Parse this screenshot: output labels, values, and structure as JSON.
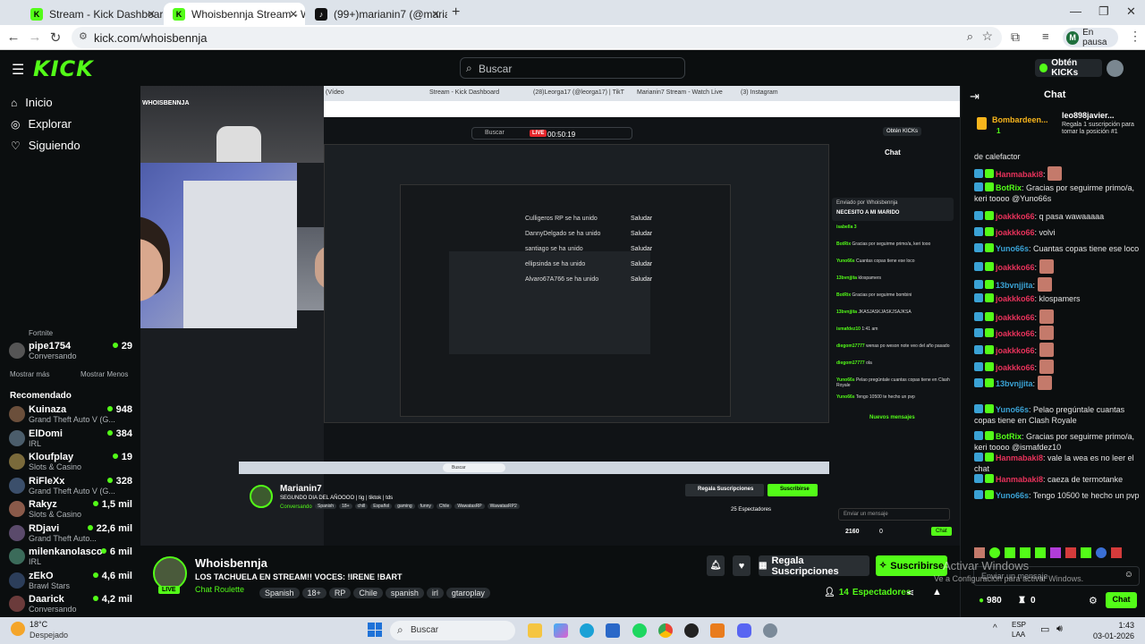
{
  "browser": {
    "tabs": [
      {
        "label": "Stream - Kick Dashboard",
        "active": false
      },
      {
        "label": "Whoisbennja Stream - Watch L",
        "active": true
      },
      {
        "label": "(99+)marianin7 (@marianin777",
        "active": false
      }
    ],
    "url": "kick.com/whoisbennja",
    "profile_label": "En pausa",
    "profile_initial": "M"
  },
  "kick": {
    "logo": "KICK",
    "search_placeholder": "Buscar",
    "get_kicks_label": "Obtén KICKs"
  },
  "sidebar": {
    "nav": [
      {
        "label": "Inicio",
        "icon": "home-icon"
      },
      {
        "label": "Explorar",
        "icon": "compass-icon"
      },
      {
        "label": "Siguiendo",
        "icon": "heart-icon"
      }
    ],
    "partial_cat": "Fortnite",
    "following_extra": {
      "name": "pipe1754",
      "category": "Conversando",
      "viewers": "29"
    },
    "show_more": "Mostrar más",
    "show_less": "Mostrar Menos",
    "recommended_title": "Recomendado",
    "recommended": [
      {
        "name": "Kuinaza",
        "category": "Grand Theft Auto V (G...",
        "viewers": "948"
      },
      {
        "name": "ElDomi",
        "category": "IRL",
        "viewers": "384"
      },
      {
        "name": "Kloufplay",
        "category": "Slots & Casino",
        "viewers": "19"
      },
      {
        "name": "RiFleXx",
        "category": "Grand Theft Auto V (G...",
        "viewers": "328"
      },
      {
        "name": "Rakyz",
        "category": "Slots & Casino",
        "viewers": "1,5 mil"
      },
      {
        "name": "RDjavi",
        "category": "Grand Theft Auto...",
        "viewers": "22,6 mil"
      },
      {
        "name": "milenkanolasco",
        "category": "IRL",
        "viewers": "6 mil"
      },
      {
        "name": "zEkO",
        "category": "Brawl Stars",
        "viewers": "4,6 mil"
      },
      {
        "name": "Daarick",
        "category": "Conversando",
        "viewers": "4,2 mil"
      }
    ]
  },
  "stream": {
    "name": "Whoisbennja",
    "title": "LOS TACHUELA EN STREAM!! VOCES: !IRENE !BART",
    "category": "Chat Roulette",
    "tags": [
      "Spanish",
      "18+",
      "RP",
      "Chile",
      "spanish",
      "irl",
      "gtaroplay"
    ],
    "live_label": "LIVE",
    "subscribe_gift_label": "Regala Suscripciones",
    "subscribe_label": "Suscribirse",
    "viewers": "14",
    "viewers_label": "Espectadores"
  },
  "video_inner": {
    "tabs": [
      "(Vídeo",
      "Stream - Kick Dashboard",
      "(28)Leorga17 (@leorga17) | TikT",
      "Marianin7 Stream - Watch Live",
      "(3) Instagram"
    ],
    "search": "Buscar",
    "live_badge": "LIVE",
    "timer": "00:50:19",
    "channel": "Marianin7",
    "channel_title": "SEGUNDO DIA DEL AÑOOOO | tig | tiktok | tds",
    "channel_category": "Conversando",
    "channel_tags": [
      "Spanish",
      "18+",
      "chill",
      "Español",
      "gaming",
      "funny",
      "Chile",
      "WawatasRP",
      "WawatasRP2"
    ],
    "gift_label": "Regala Suscripciones",
    "subscribe_label": "Suscribirse",
    "viewers": "25 Espectadores",
    "chat_title": "Chat",
    "chat_input": "Enviar un mensaje",
    "chat_kicks": "2160",
    "chat_zero": "0",
    "chat_btn": "Chat",
    "bubble": "ellipsinda se ha unido",
    "joined": [
      "Culligeros RP se ha unido",
      "DannyDelgado se ha unido",
      "santiago se ha unido",
      "ellipsinda se ha unido",
      "Alvaro67A766 se ha unido"
    ],
    "greet": "Saludar",
    "pinned_by": "Enviado por Whoisbennja",
    "pinned_msg": "NECESITO A MI MARIDO",
    "new_messages": "Nuevos mensajes",
    "taskbar_search": "Buscar",
    "get_kicks": "Obtén KICKs",
    "chat_lines": [
      {
        "user": "isabella 3",
        "text": ""
      },
      {
        "user": "BotRix",
        "text": "Gracias por seguirme primo/a, keri tooo"
      },
      {
        "user": "Yuno66s",
        "text": "Cuantas copas tiene ese loco"
      },
      {
        "user": "13bvnjjita",
        "text": "klospamers"
      },
      {
        "user": "BotRix",
        "text": "Gracias por seguirme bombini"
      },
      {
        "user": "13bvnjjita",
        "text": "JKASJASKJASKJSAJKSA"
      },
      {
        "user": "ismafdez10",
        "text": "1:41 am"
      },
      {
        "user": "diegom17777",
        "text": "wenas po weson note veo del año pasado"
      },
      {
        "user": "diegom17777",
        "text": "ola"
      },
      {
        "user": "Yuno66s",
        "text": "Pelao pregúntale cuantas copas tiene en Clash Royale"
      },
      {
        "user": "Yuno66s",
        "text": "Tengo 10500 te hecho un pvp"
      }
    ]
  },
  "webcam_label": "WHOISBENNJA",
  "chat": {
    "title": "Chat",
    "pinned_user": "Bombardeen...",
    "pinned_count": "1",
    "gift_user": "leo898javier...",
    "gift_text": "Regala 1 suscripción para tomar la posición #1",
    "first_line": "de calefactor",
    "messages": [
      {
        "user": "Hanmabaki8",
        "text": "",
        "color": "#e8325b",
        "emote": true
      },
      {
        "user": "BotRix",
        "text": "Gracias por seguirme primo/a, keri toooo @Yuno66s",
        "color": "#53fc18",
        "emote": false
      },
      {
        "user": "joakkko66",
        "text": "q pasa wawaaaaa",
        "color": "#e8325b",
        "emote": false
      },
      {
        "user": "joakkko66",
        "text": "volvi",
        "color": "#e8325b",
        "emote": false
      },
      {
        "user": "Yuno66s",
        "text": "Cuantas copas tiene ese loco",
        "color": "#3aa2d5",
        "emote": false
      },
      {
        "user": "joakkko66",
        "text": "",
        "color": "#e8325b",
        "emote": true
      },
      {
        "user": "13bvnjjita",
        "text": "",
        "color": "#3aa2d5",
        "emote": true
      },
      {
        "user": "joakkko66",
        "text": "klospamers",
        "color": "#e8325b",
        "emote": false
      },
      {
        "user": "joakkko66",
        "text": "",
        "color": "#e8325b",
        "emote": true
      },
      {
        "user": "joakkko66",
        "text": "",
        "color": "#e8325b",
        "emote": true
      },
      {
        "user": "joakkko66",
        "text": "",
        "color": "#e8325b",
        "emote": true
      },
      {
        "user": "joakkko66",
        "text": "",
        "color": "#e8325b",
        "emote": true
      },
      {
        "user": "13bvnjjita",
        "text": "",
        "color": "#3aa2d5",
        "emote": true
      },
      {
        "user": "Yuno66s",
        "text": "Pelao pregúntale cuantas copas tiene en Clash Royale",
        "color": "#3aa2d5",
        "emote": false
      },
      {
        "user": "BotRix",
        "text": "Gracias por seguirme primo/a, keri toooo @ismafdez10",
        "color": "#53fc18",
        "emote": false
      },
      {
        "user": "Hanmabaki8",
        "text": "vale la wea es no leer el chat",
        "color": "#e8325b",
        "emote": false
      },
      {
        "user": "Hanmabaki8",
        "text": "caeza de termotanke",
        "color": "#e8325b",
        "emote": false
      },
      {
        "user": "Yuno66s",
        "text": "Tengo 10500 te hecho un pvp",
        "color": "#3aa2d5",
        "emote": false
      }
    ],
    "input_placeholder": "Enviar un mensaje",
    "kicks": "980",
    "zero": "0",
    "send_label": "Chat",
    "watermark_title": "Activar Windows",
    "watermark_sub": "Ve a Configuración para activar Windows."
  },
  "taskbar": {
    "weather_temp": "18°C",
    "weather_desc": "Despejado",
    "search": "Buscar",
    "lang": "ESP",
    "lang2": "LAA",
    "time": "1:43",
    "date": "03-01-2026"
  },
  "colors": {
    "accent": "#53fc18",
    "bg": "#0b0e0f",
    "taskbar": "#d9dfe8"
  }
}
